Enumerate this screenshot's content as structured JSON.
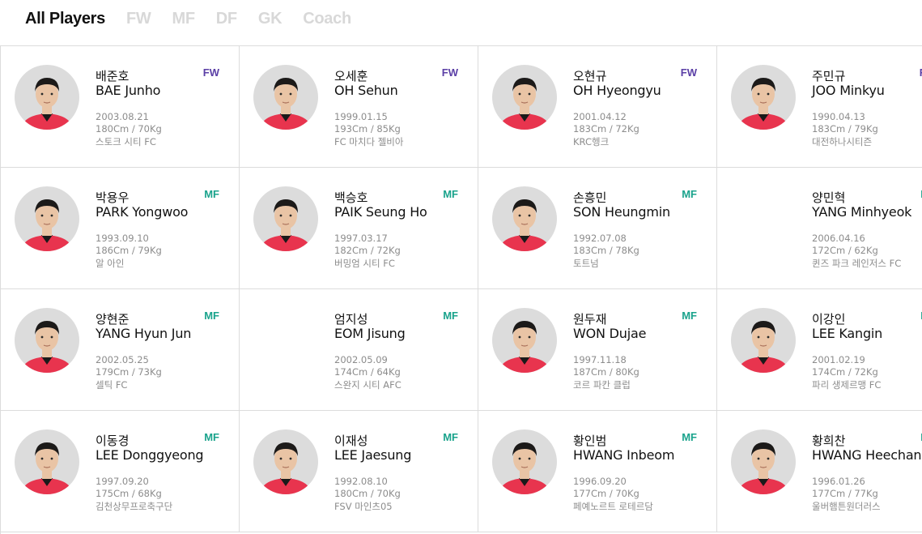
{
  "tabs": [
    "All Players",
    "FW",
    "MF",
    "DF",
    "GK",
    "Coach"
  ],
  "active_tab": 0,
  "colors": {
    "FW": "#5b3fa6",
    "MF": "#1aa38c",
    "text": "#111111",
    "muted": "#8c8c8c",
    "border": "#dcdcdc",
    "jersey": "#e8344e"
  },
  "players": [
    {
      "kname": "배준호",
      "ename": "BAE Junho",
      "pos": "FW",
      "birth": "2003.08.21",
      "body": "180Cm / 70Kg",
      "club": "스토크 시티 FC",
      "photo": true
    },
    {
      "kname": "오세훈",
      "ename": "OH Sehun",
      "pos": "FW",
      "birth": "1999.01.15",
      "body": "193Cm / 85Kg",
      "club": "FC 마치다 젤비아",
      "photo": true
    },
    {
      "kname": "오현규",
      "ename": "OH Hyeongyu",
      "pos": "FW",
      "birth": "2001.04.12",
      "body": "183Cm / 72Kg",
      "club": "KRC헹크",
      "photo": true
    },
    {
      "kname": "주민규",
      "ename": "JOO Minkyu",
      "pos": "FW",
      "birth": "1990.04.13",
      "body": "183Cm / 79Kg",
      "club": "대전하나시티즌",
      "photo": true
    },
    {
      "kname": "박용우",
      "ename": "PARK Yongwoo",
      "pos": "MF",
      "birth": "1993.09.10",
      "body": "186Cm / 79Kg",
      "club": "알 아인",
      "photo": true
    },
    {
      "kname": "백승호",
      "ename": "PAIK Seung Ho",
      "pos": "MF",
      "birth": "1997.03.17",
      "body": "182Cm / 72Kg",
      "club": "버밍엄 시티 FC",
      "photo": true
    },
    {
      "kname": "손흥민",
      "ename": "SON Heungmin",
      "pos": "MF",
      "birth": "1992.07.08",
      "body": "183Cm / 78Kg",
      "club": "토트넘",
      "photo": true
    },
    {
      "kname": "양민혁",
      "ename": "YANG Minhyeok",
      "pos": "MF",
      "birth": "2006.04.16",
      "body": "172Cm / 62Kg",
      "club": "퀸즈 파크 레인저스 FC",
      "photo": false
    },
    {
      "kname": "양현준",
      "ename": "YANG Hyun Jun",
      "pos": "MF",
      "birth": "2002.05.25",
      "body": "179Cm / 73Kg",
      "club": "셀틱 FC",
      "photo": true
    },
    {
      "kname": "엄지성",
      "ename": "EOM Jisung",
      "pos": "MF",
      "birth": "2002.05.09",
      "body": "174Cm / 64Kg",
      "club": "스완지 시티 AFC",
      "photo": false
    },
    {
      "kname": "원두재",
      "ename": "WON Dujae",
      "pos": "MF",
      "birth": "1997.11.18",
      "body": "187Cm / 80Kg",
      "club": "코르 파칸 클럽",
      "photo": true
    },
    {
      "kname": "이강인",
      "ename": "LEE Kangin",
      "pos": "MF",
      "birth": "2001.02.19",
      "body": "174Cm / 72Kg",
      "club": "파리 생제르맹 FC",
      "photo": true
    },
    {
      "kname": "이동경",
      "ename": "LEE Donggyeong",
      "pos": "MF",
      "birth": "1997.09.20",
      "body": "175Cm / 68Kg",
      "club": "김천상무프로축구단",
      "photo": true
    },
    {
      "kname": "이재성",
      "ename": "LEE Jaesung",
      "pos": "MF",
      "birth": "1992.08.10",
      "body": "180Cm / 70Kg",
      "club": "FSV 마인츠05",
      "photo": true
    },
    {
      "kname": "황인범",
      "ename": "HWANG Inbeom",
      "pos": "MF",
      "birth": "1996.09.20",
      "body": "177Cm / 70Kg",
      "club": "페예노르트 로테르담",
      "photo": true
    },
    {
      "kname": "황희찬",
      "ename": "HWANG Heechan",
      "pos": "MF",
      "birth": "1996.01.26",
      "body": "177Cm / 77Kg",
      "club": "울버햄튼원더러스",
      "photo": true
    }
  ]
}
